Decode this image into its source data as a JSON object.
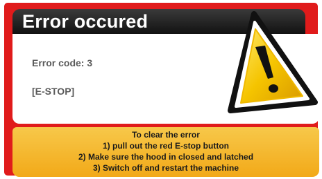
{
  "dialog": {
    "title": "Error occured",
    "error_code": "Error code: 3",
    "error_name": "[E-STOP]",
    "icon": "warning-icon"
  },
  "instructions": {
    "heading": "To clear the error",
    "steps": [
      "1) pull out the red E-stop button",
      "2) Make sure the hood in closed and latched",
      "3) Switch off and restart the machine"
    ]
  },
  "colors": {
    "frame": "#e01b1b",
    "header": "#1e1e1e",
    "instructions_background": "#f5b82e",
    "warning_yellow": "#f5c400"
  }
}
